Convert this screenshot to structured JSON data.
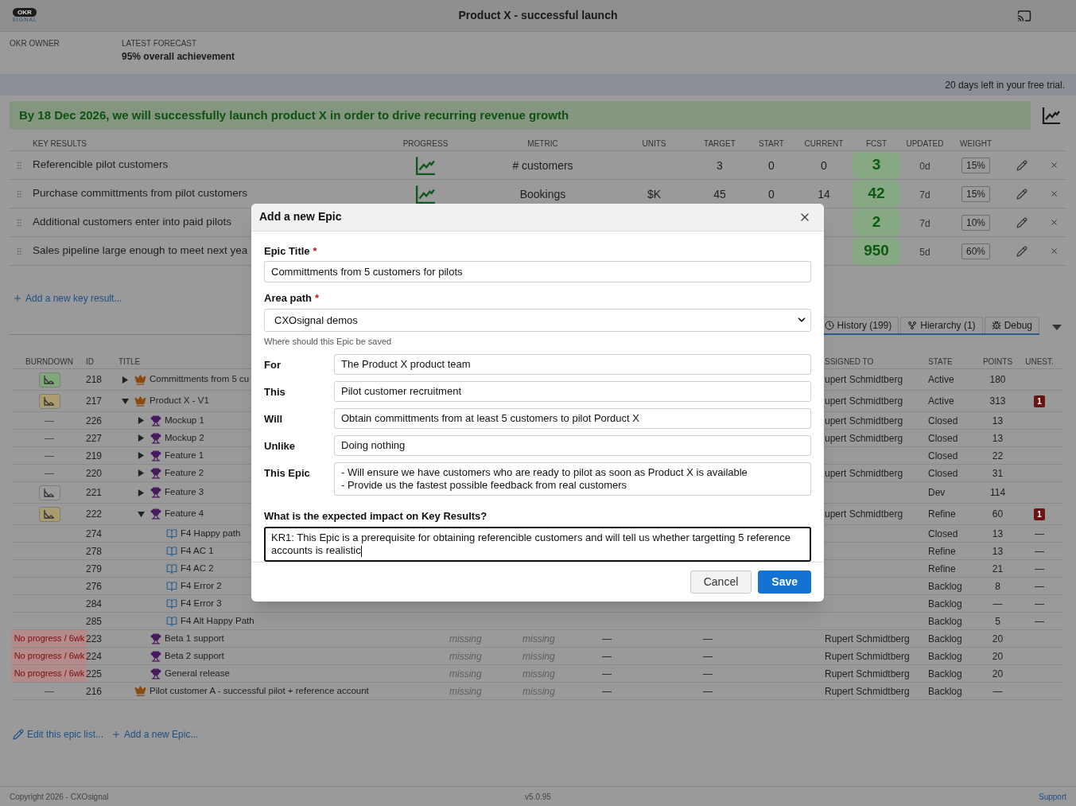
{
  "header": {
    "logo_word": "OKR",
    "logo_subword": "SIGNAL",
    "title": "Product X - successful launch"
  },
  "summary": {
    "owner_label": "OKR OWNER",
    "forecast_label": "LATEST FORECAST",
    "forecast_value": "95% overall achievement"
  },
  "trial_notice": "20 days left in your free trial.",
  "objective": "By 18 Dec 2026, we will successfully launch product X in order to drive recurring revenue growth",
  "key_results": {
    "columns": [
      "KEY RESULTS",
      "PROGRESS",
      "METRIC",
      "UNITS",
      "TARGET",
      "START",
      "CURRENT",
      "FCST",
      "UPDATED",
      "WEIGHT"
    ],
    "rows": [
      {
        "name": "Referencible pilot customers",
        "progress_chart": true,
        "metric": "# customers",
        "target": "3",
        "start": "0",
        "current": "0",
        "fcst": "3",
        "updated": "0d",
        "weight": "15%"
      },
      {
        "name": "Purchase committments from pilot customers",
        "progress_chart": true,
        "metric": "Bookings",
        "units": "$K",
        "target": "45",
        "start": "0",
        "current": "14",
        "fcst": "42",
        "updated": "7d",
        "weight": "15%"
      },
      {
        "name": "Additional customers enter into paid pilots",
        "fcst": "2",
        "updated": "7d",
        "weight": "10%"
      },
      {
        "name": "Sales pipeline large enough to meet next yea",
        "fcst": "950",
        "updated": "5d",
        "weight": "60%"
      }
    ]
  },
  "add_key_result": "Add a new key result...",
  "tabs": [
    {
      "kind": "history",
      "label": "History (199)",
      "selected": false
    },
    {
      "kind": "hierarchy",
      "label": "Hierarchy (1)",
      "selected": false
    },
    {
      "kind": "debug",
      "label": "Debug",
      "selected": false
    }
  ],
  "epics": {
    "columns": [
      "BURNDOWN",
      "ID",
      "TITLE",
      "SSIGNED TO",
      "STATE",
      "POINTS",
      "UNEST."
    ],
    "rows": [
      {
        "id": "218",
        "kind": "epic",
        "title": "Committments from 5 cu",
        "expanded": false,
        "burndown": {
          "kind": "chart",
          "color": "#7fa878"
        },
        "assigned_to": "upert Schmidtberg",
        "state": "Active",
        "points": "180"
      },
      {
        "id": "217",
        "kind": "epic",
        "title": "Product X - V1",
        "expanded": true,
        "burndown": {
          "kind": "chart",
          "color": "#a89c70"
        },
        "assigned_to": "upert Schmidtberg",
        "state": "Active",
        "points": "313",
        "unest": "1",
        "children": [
          {
            "id": "226",
            "kind": "feature",
            "title": "Mockup 1",
            "expanded": false,
            "burndown": {
              "kind": "text",
              "text": "—"
            },
            "assigned_to": "upert Schmidtberg",
            "state": "Closed",
            "points": "13"
          },
          {
            "id": "227",
            "kind": "feature",
            "title": "Mockup 2",
            "expanded": false,
            "burndown": {
              "kind": "text",
              "text": "—"
            },
            "assigned_to": "upert Schmidtberg",
            "state": "Closed",
            "points": "13"
          },
          {
            "id": "219",
            "kind": "feature",
            "title": "Feature 1",
            "expanded": false,
            "burndown": {
              "kind": "text",
              "text": "—"
            },
            "state": "Closed",
            "points": "22"
          },
          {
            "id": "220",
            "kind": "feature",
            "title": "Feature 2",
            "expanded": false,
            "burndown": {
              "kind": "text",
              "text": "—"
            },
            "assigned_to": "upert Schmidtberg",
            "state": "Closed",
            "points": "31"
          },
          {
            "id": "221",
            "kind": "feature",
            "title": "Feature 3",
            "expanded": false,
            "burndown": {
              "kind": "chart",
              "color": "#9c9c9c"
            },
            "state": "Dev",
            "points": "114"
          },
          {
            "id": "222",
            "kind": "feature",
            "title": "Feature 4",
            "expanded": true,
            "burndown": {
              "kind": "chart",
              "color": "#a89c70"
            },
            "assigned_to": "upert Schmidtberg",
            "state": "Refine",
            "points": "60",
            "unest": "1",
            "children": [
              {
                "id": "274",
                "kind": "story",
                "title": "F4 Happy path",
                "state": "Closed",
                "points": "13",
                "unest": "—"
              },
              {
                "id": "278",
                "kind": "story",
                "title": "F4 AC 1",
                "state": "Refine",
                "points": "13",
                "unest": "—"
              },
              {
                "id": "279",
                "kind": "story",
                "title": "F4 AC 2",
                "state": "Refine",
                "points": "21",
                "unest": "—"
              },
              {
                "id": "276",
                "kind": "story",
                "title": "F4 Error 2",
                "state": "Backlog",
                "points": "8",
                "unest": "—"
              },
              {
                "id": "284",
                "kind": "story",
                "title": "F4 Error 3",
                "state": "Backlog",
                "points": "—",
                "unest": "—"
              },
              {
                "id": "285",
                "kind": "story",
                "title": "F4 Alt Happy Path",
                "state": "Backlog",
                "points": "5",
                "unest": "—"
              }
            ]
          },
          {
            "id": "223",
            "kind": "feature",
            "title": "Beta 1 support",
            "burndown": {
              "kind": "alert",
              "text": "No progress / 6wk"
            },
            "column_4": "missing",
            "column_5": "missing",
            "column_6": "—",
            "column_7": "—",
            "assigned_to": "Rupert Schmidtberg",
            "state": "Backlog",
            "points": "20"
          },
          {
            "id": "224",
            "kind": "feature",
            "title": "Beta 2 support",
            "burndown": {
              "kind": "alert",
              "text": "No progress / 6wk"
            },
            "column_4": "missing",
            "column_5": "missing",
            "column_6": "—",
            "column_7": "—",
            "assigned_to": "Rupert Schmidtberg",
            "state": "Backlog",
            "points": "20"
          },
          {
            "id": "225",
            "kind": "feature",
            "title": "General release",
            "burndown": {
              "kind": "alert",
              "text": "No progress / 6wk"
            },
            "column_4": "missing",
            "column_5": "missing",
            "column_6": "—",
            "column_7": "—",
            "assigned_to": "Rupert Schmidtberg",
            "state": "Backlog",
            "points": "20"
          }
        ]
      },
      {
        "id": "216",
        "kind": "epic",
        "title": "Pilot customer A - successful pilot + reference account",
        "burndown": {
          "kind": "text",
          "text": "—"
        },
        "column_4": "missing",
        "column_5": "missing",
        "column_6": "—",
        "column_7": "—",
        "assigned_to": "Rupert Schmidtberg",
        "state": "Backlog",
        "points": "—"
      }
    ]
  },
  "list_actions": [
    {
      "kind": "edit",
      "label": "Edit this epic list..."
    },
    {
      "kind": "add",
      "label": "Add a new Epic..."
    }
  ],
  "footer": {
    "copyright": "Copyright 2026 - CXOsignal",
    "version": "v5.0.95",
    "support": "Support"
  },
  "modal": {
    "title": "Add a new Epic",
    "fields": [
      {
        "kind": "text",
        "label": "Epic Title",
        "required_mark": "*",
        "value": "Committments from 5 customers for pilots"
      },
      {
        "kind": "select",
        "label": "Area path",
        "required_mark": "*",
        "value": "CXOsignal demos",
        "hint": "Where should this Epic be saved"
      },
      {
        "kind": "inline",
        "label": "For",
        "value": "The Product X product team"
      },
      {
        "kind": "inline",
        "label": "This",
        "value": "Pilot customer recruitment"
      },
      {
        "kind": "inline",
        "label": "Will",
        "value": "Obtain committments from at least 5 customers to pilot Porduct X"
      },
      {
        "kind": "inline",
        "label": "Unlike",
        "value": "Doing nothing"
      },
      {
        "kind": "inline",
        "label": "This Epic",
        "value": "- Will ensure we have customers who are ready to pilot as soon as Product X is available\n- Provide us the fastest possible feedback from real customers"
      },
      {
        "kind": "textarea",
        "label": "What is the expected impact on Key Results?",
        "value": "KR1: This Epic is a prerequisite for obtaining referencible customers and will tell us whether targetting 5 reference accounts is realistic",
        "focused": true
      }
    ],
    "buttons": [
      {
        "kind": "secondary",
        "label": "Cancel"
      },
      {
        "kind": "primary",
        "label": "Save"
      }
    ]
  }
}
